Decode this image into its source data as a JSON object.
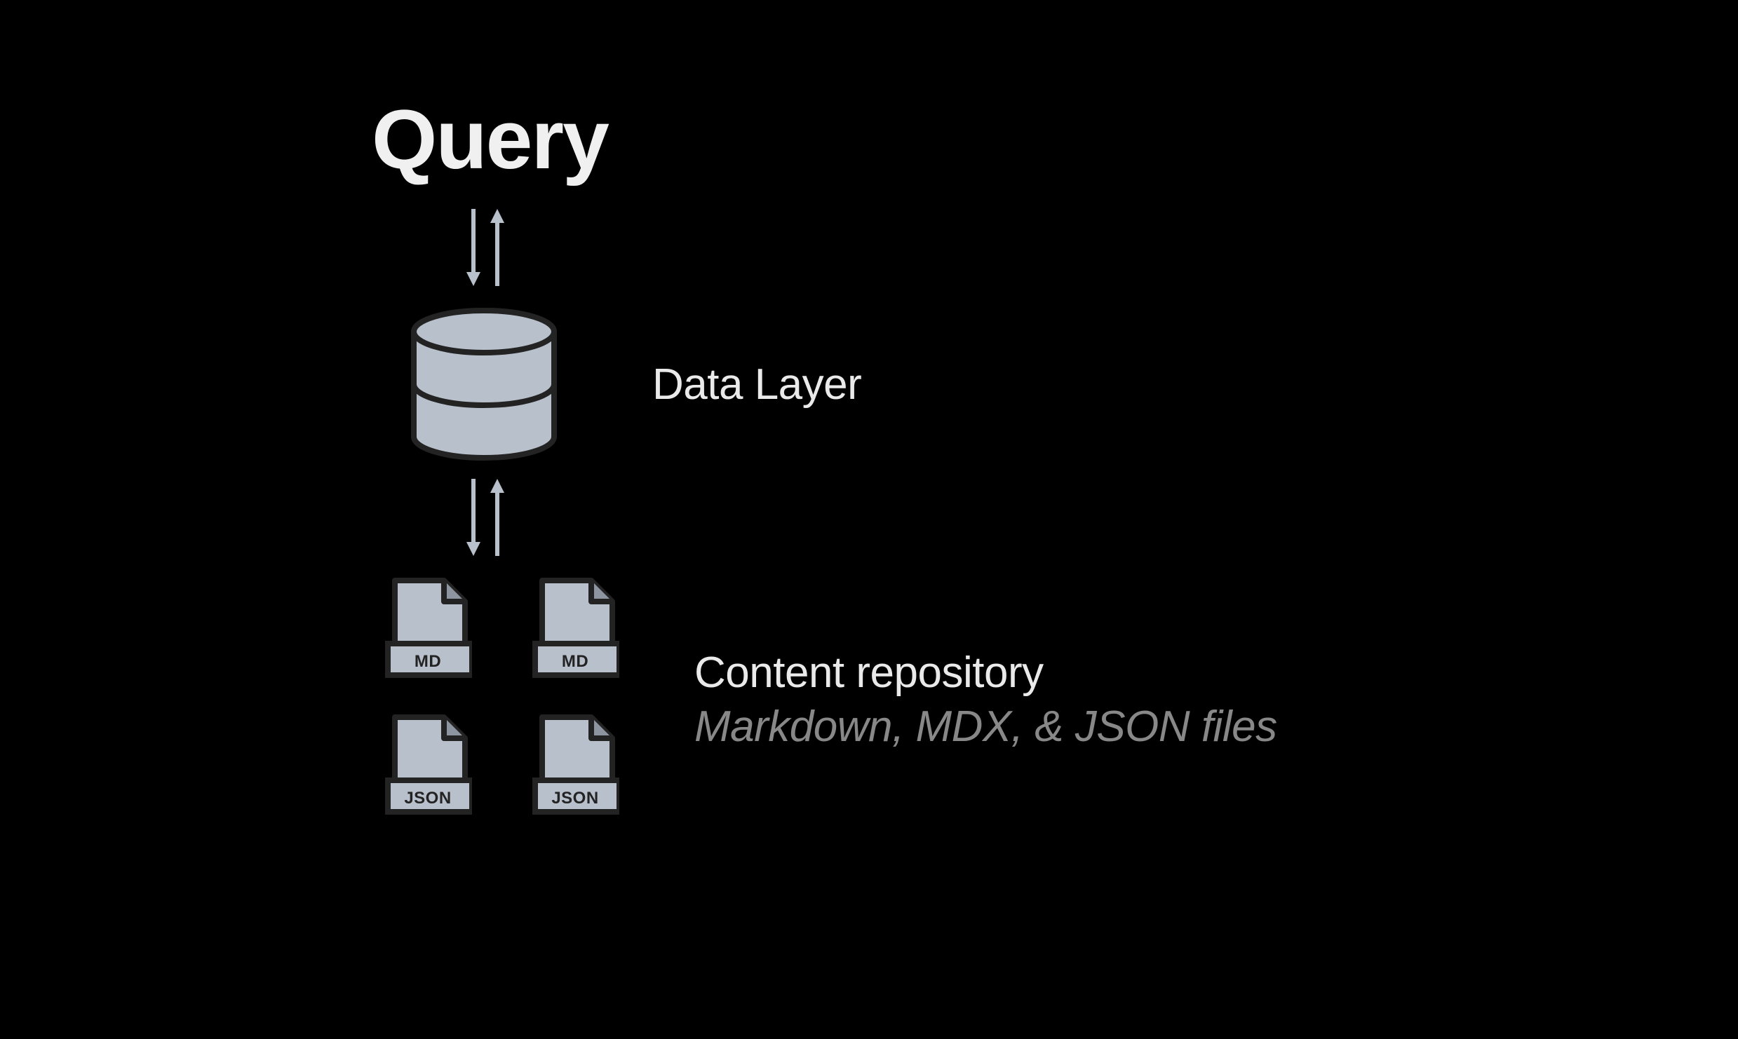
{
  "query": {
    "label": "Query"
  },
  "data_layer": {
    "label": "Data Layer"
  },
  "content_repo": {
    "title": "Content repository",
    "subtitle": "Markdown, MDX, & JSON files"
  },
  "files": [
    {
      "label": "MD"
    },
    {
      "label": "MD"
    },
    {
      "label": "JSON"
    },
    {
      "label": "JSON"
    }
  ]
}
